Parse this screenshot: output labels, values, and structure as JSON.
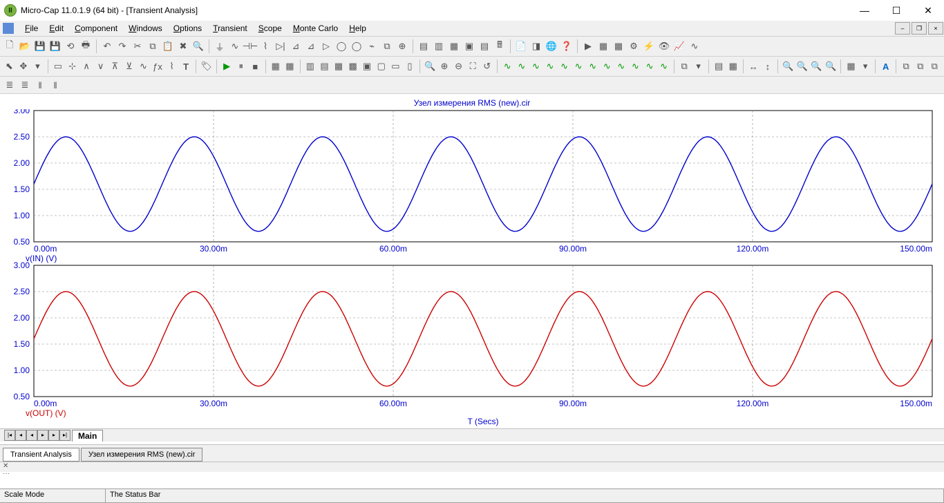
{
  "window": {
    "title": "Micro-Cap 11.0.1.9 (64 bit) - [Transient Analysis]"
  },
  "menu": {
    "items": [
      "File",
      "Edit",
      "Component",
      "Windows",
      "Options",
      "Transient",
      "Scope",
      "Monte Carlo",
      "Help"
    ]
  },
  "plot": {
    "title": "Узел измерения RMS (new).cir",
    "xlabel": "T (Secs)",
    "x_ticks": [
      "0.00m",
      "30.00m",
      "60.00m",
      "90.00m",
      "120.00m",
      "150.00m"
    ],
    "panes": [
      {
        "label": "v(IN) (V)",
        "color": "#0000cc",
        "y_ticks": [
          "0.50",
          "1.00",
          "1.50",
          "2.00",
          "2.50",
          "3.00"
        ]
      },
      {
        "label": "v(OUT) (V)",
        "color": "#cc0000",
        "y_ticks": [
          "0.50",
          "1.00",
          "1.50",
          "2.00",
          "2.50",
          "3.00"
        ]
      }
    ]
  },
  "chart_data": [
    {
      "type": "line",
      "title": "v(IN) (V)",
      "xlabel": "T (Secs)",
      "ylabel": "V",
      "xlim": [
        0,
        0.15
      ],
      "ylim": [
        0.5,
        3.0
      ],
      "series": [
        {
          "name": "v(IN)",
          "color": "#0000cc",
          "function": "1.6 + 0.9*sin(2*pi*46.67*t)",
          "amplitude": 0.9,
          "offset": 1.6,
          "frequency_hz": 46.67,
          "period_s": 0.02143
        }
      ]
    },
    {
      "type": "line",
      "title": "v(OUT) (V)",
      "xlabel": "T (Secs)",
      "ylabel": "V",
      "xlim": [
        0,
        0.15
      ],
      "ylim": [
        0.5,
        3.0
      ],
      "series": [
        {
          "name": "v(OUT)",
          "color": "#cc0000",
          "function": "1.6 + 0.9*sin(2*pi*46.67*t)",
          "amplitude": 0.9,
          "offset": 1.6,
          "frequency_hz": 46.67,
          "period_s": 0.02143
        }
      ]
    }
  ],
  "nav_tabs": {
    "main": "Main"
  },
  "bottom_tabs": {
    "active": "Transient Analysis",
    "other": "Узел измерения RMS (new).cir"
  },
  "status": {
    "mode": "Scale Mode",
    "message": "The Status Bar"
  }
}
